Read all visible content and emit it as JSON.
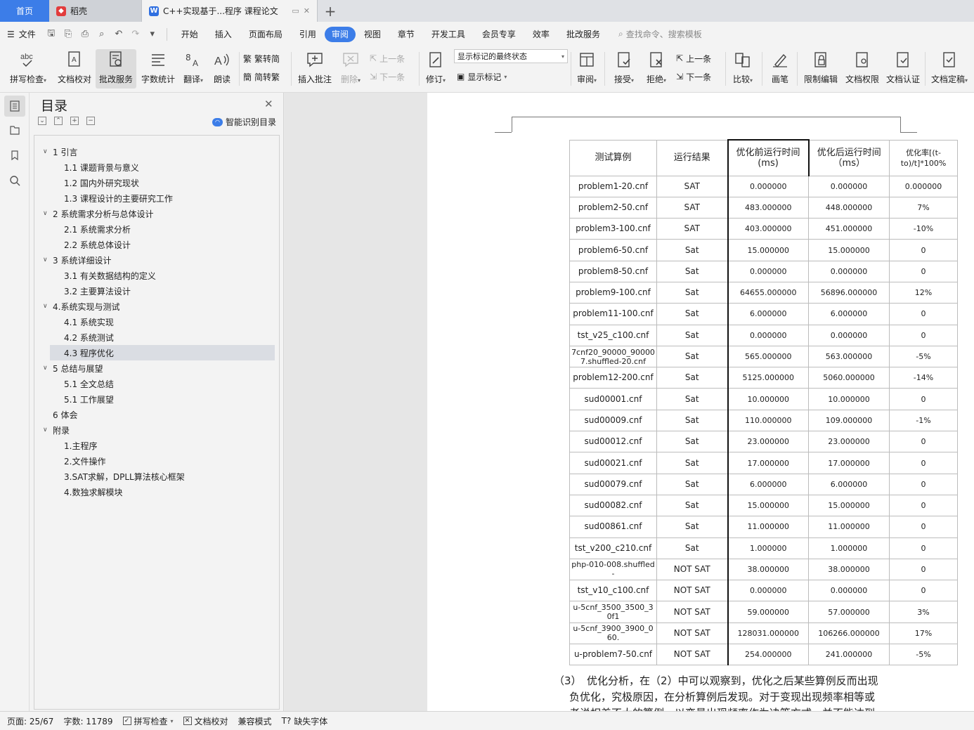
{
  "tabs": {
    "home": "首页",
    "daoke": "稻壳",
    "doc": "C++实现基于...程序 课程论文",
    "add": "+"
  },
  "menu": {
    "file": "文件",
    "items": [
      "开始",
      "插入",
      "页面布局",
      "引用",
      "审阅",
      "视图",
      "章节",
      "开发工具",
      "会员专享",
      "效率",
      "批改服务"
    ],
    "active_index": 4,
    "search": "查找命令、搜索模板"
  },
  "toolbar": {
    "spell": "拼写检查",
    "proofread": "文档校对",
    "review_service": "批改服务",
    "word_count": "字数统计",
    "translate": "翻译",
    "read_aloud": "朗读",
    "trad_to_simp": "繁转简",
    "simp_to_trad": "简转繁",
    "insert_comment": "插入批注",
    "delete": "删除",
    "prev": "上一条",
    "next": "下一条",
    "revise": "修订",
    "markup_select": "显示标记的最终状态",
    "show_markup": "显示标记",
    "review": "审阅",
    "accept": "接受",
    "reject": "拒绝",
    "prev2": "上一条",
    "next2": "下一条",
    "compare": "比较",
    "pen": "画笔",
    "restrict_edit": "限制编辑",
    "doc_permission": "文档权限",
    "doc_cert": "文档认证",
    "doc_final": "文档定稿"
  },
  "toc": {
    "title": "目录",
    "smart": "智能识别目录",
    "items": [
      {
        "label": "1 引言",
        "level": 1,
        "arrow": true
      },
      {
        "label": "1.1  课题背景与意义",
        "level": 2
      },
      {
        "label": "1.2  国内外研究现状",
        "level": 2
      },
      {
        "label": "1.3  课程设计的主要研究工作",
        "level": 2
      },
      {
        "label": "2  系统需求分析与总体设计",
        "level": 1,
        "arrow": true
      },
      {
        "label": "2.1    系统需求分析",
        "level": 2
      },
      {
        "label": "2.2  系统总体设计",
        "level": 2
      },
      {
        "label": "3  系统详细设计",
        "level": 1,
        "arrow": true
      },
      {
        "label": "3.1    有关数据结构的定义",
        "level": 2
      },
      {
        "label": "3.2    主要算法设计",
        "level": 2
      },
      {
        "label": "4.系统实现与测试",
        "level": 1,
        "arrow": true
      },
      {
        "label": "4.1  系统实现",
        "level": 2
      },
      {
        "label": "4.2  系统测试",
        "level": 2
      },
      {
        "label": "4.3 程序优化",
        "level": 2,
        "selected": true
      },
      {
        "label": "5  总结与展望",
        "level": 1,
        "arrow": true
      },
      {
        "label": "5.1  全文总结",
        "level": 2
      },
      {
        "label": "5.1  工作展望",
        "level": 2
      },
      {
        "label": "6 体会",
        "level": 1
      },
      {
        "label": "附录",
        "level": 1,
        "arrow": true
      },
      {
        "label": "1.主程序",
        "level": 2
      },
      {
        "label": "2.文件操作",
        "level": 2
      },
      {
        "label": "3.SAT求解，DPLL算法核心框架",
        "level": 2
      },
      {
        "label": "4.数独求解模块",
        "level": 2
      }
    ]
  },
  "table": {
    "headers": [
      "测试算例",
      "运行结果",
      "优化前运行时间(ms)",
      "优化后运行时间（ms）",
      "优化率[(t-to)/t]*100%"
    ],
    "rows": [
      [
        "problem1-20.cnf",
        "SAT",
        "0.000000",
        "0.000000",
        "0.000000"
      ],
      [
        "problem2-50.cnf",
        "SAT",
        "483.000000",
        "448.000000",
        "7%"
      ],
      [
        "problem3-100.cnf",
        "SAT",
        "403.000000",
        "451.000000",
        "-10%"
      ],
      [
        "problem6-50.cnf",
        "Sat",
        "15.000000",
        "15.000000",
        "0"
      ],
      [
        "problem8-50.cnf",
        "Sat",
        "0.000000",
        "0.000000",
        "0"
      ],
      [
        "problem9-100.cnf",
        "Sat",
        "64655.000000",
        "56896.000000",
        "12%"
      ],
      [
        "problem11-100.cnf",
        "Sat",
        "6.000000",
        "6.000000",
        "0"
      ],
      [
        "tst_v25_c100.cnf",
        "Sat",
        "0.000000",
        "0.000000",
        "0"
      ],
      [
        "7cnf20_90000_900007.shuffled-20.cnf",
        "Sat",
        "565.000000",
        "563.000000",
        "-5%"
      ],
      [
        "problem12-200.cnf",
        "Sat",
        "5125.000000",
        "5060.000000",
        "-14%"
      ],
      [
        "sud00001.cnf",
        "Sat",
        "10.000000",
        "10.000000",
        "0"
      ],
      [
        "sud00009.cnf",
        "Sat",
        "110.000000",
        "109.000000",
        "-1%"
      ],
      [
        "sud00012.cnf",
        "Sat",
        "23.000000",
        "23.000000",
        "0"
      ],
      [
        "sud00021.cnf",
        "Sat",
        "17.000000",
        "17.000000",
        "0"
      ],
      [
        "sud00079.cnf",
        "Sat",
        "6.000000",
        "6.000000",
        "0"
      ],
      [
        "sud00082.cnf",
        "Sat",
        "15.000000",
        "15.000000",
        "0"
      ],
      [
        "sud00861.cnf",
        "Sat",
        "11.000000",
        "11.000000",
        "0"
      ],
      [
        "tst_v200_c210.cnf",
        "Sat",
        "1.000000",
        "1.000000",
        "0"
      ],
      [
        "php-010-008.shuffled-",
        "NOT SAT",
        "38.000000",
        "38.000000",
        "0"
      ],
      [
        "tst_v10_c100.cnf",
        "NOT SAT",
        "0.000000",
        "0.000000",
        "0"
      ],
      [
        "u-5cnf_3500_3500_30f1",
        "NOT SAT",
        "59.000000",
        "57.000000",
        "3%"
      ],
      [
        "u-5cnf_3900_3900_060.",
        "NOT SAT",
        "128031.000000",
        "106266.000000",
        "17%"
      ],
      [
        "u-problem7-50.cnf",
        "NOT SAT",
        "254.000000",
        "241.000000",
        "-5%"
      ]
    ]
  },
  "caption": {
    "line1": "（3）　优化分析，在（2）中可以观察到，优化之后某些算例反而出现",
    "line2": "负优化，究极原因，在分析算例后发现。对于变现出现频率相等或",
    "line3": "者说相差不大的算例，以变量出现频率作为决策方式，并不能达到"
  },
  "status": {
    "page": "页面: 25/67",
    "words": "字数: 11789",
    "spell": "拼写检查",
    "proof": "文档校对",
    "compat": "兼容模式",
    "missing_font": "缺失字体"
  }
}
